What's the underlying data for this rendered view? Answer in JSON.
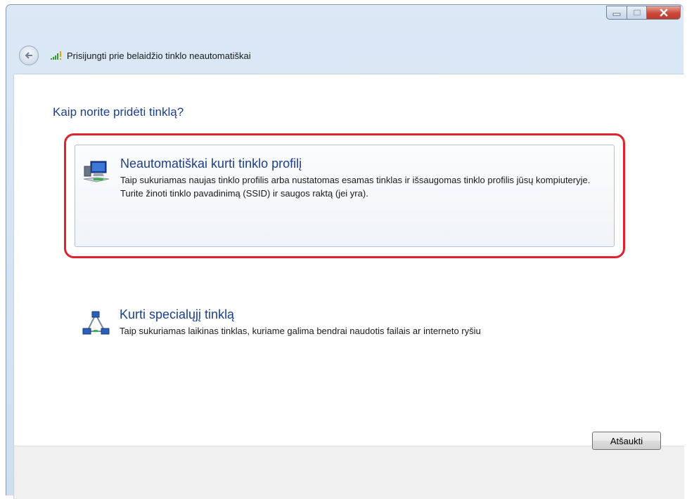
{
  "window": {
    "title": "Prisijungti prie belaidžio tinklo neautomatiškai",
    "caption_buttons": [
      "minimize",
      "maximize",
      "close"
    ]
  },
  "main": {
    "question": "Kaip norite pridėti tinklą?",
    "options": [
      {
        "title": "Neautomatiškai kurti tinklo profilį",
        "description": "Taip sukuriamas naujas tinklo profilis arba nustatomas esamas tinklas ir išsaugomas tinklo profilis jūsų kompiuteryje. Turite žinoti tinklo pavadinimą (SSID) ir saugos raktą (jei yra).",
        "icon": "computer-network-icon",
        "highlighted": true
      },
      {
        "title": "Kurti specialųjį tinklą",
        "description": "Taip sukuriamas laikinas tinklas, kuriame galima bendrai naudotis failais ar interneto ryšiu",
        "icon": "adhoc-network-icon",
        "highlighted": false
      }
    ]
  },
  "footer": {
    "cancel_label": "Atšaukti"
  },
  "colors": {
    "accent_text": "#1c3f8c",
    "highlight_border": "#e0222e",
    "close_button": "#c9483a"
  }
}
